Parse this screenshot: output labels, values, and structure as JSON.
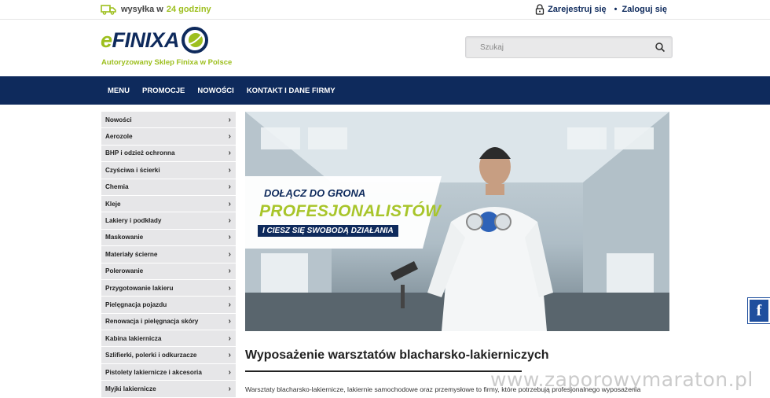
{
  "topbar": {
    "shipping_prefix": "wysyłka w",
    "shipping_highlight": "24 godziny",
    "register_label": "Zarejestruj się",
    "separator": "•",
    "login_label": "Zaloguj się"
  },
  "logo": {
    "word_e": "e",
    "word_rest": "FINIXA",
    "subtitle": "Autoryzowany Sklep Finixa w Polsce"
  },
  "search": {
    "placeholder": "Szukaj"
  },
  "nav": {
    "items": [
      "MENU",
      "PROMOCJE",
      "NOWOŚCI",
      "KONTAKT I DANE FIRMY"
    ]
  },
  "sidebar": {
    "categories": [
      "Nowości",
      "Aerozole",
      "BHP i odzież ochronna",
      "Czyściwa i ścierki",
      "Chemia",
      "Kleje",
      "Lakiery i podkłady",
      "Maskowanie",
      "Materiały ścierne",
      "Polerowanie",
      "Przygotowanie lakieru",
      "Pielęgnacja pojazdu",
      "Renowacja i pielęgnacja skóry",
      "Kabina lakiernicza",
      "Szlifierki, polerki i odkurzacze",
      "Pistolety lakiernicze i akcesoria",
      "Myjki lakiernicze"
    ],
    "chevron": "›"
  },
  "banner": {
    "line1": "DOŁĄCZ DO GRONA",
    "line2": "PROFESJONALISTÓW",
    "line3": "I CIESZ SIĘ SWOBODĄ DZIAŁANIA"
  },
  "content": {
    "heading": "Wyposażenie warsztatów blacharsko-lakierniczych",
    "paragraph": "Warsztaty blacharsko-lakiernicze, lakiernie samochodowe oraz przemysłowe to firmy, które potrzebują profesjonalnego wyposażenia"
  },
  "social": {
    "facebook_glyph": "f"
  },
  "watermark": "www.zaporowymaraton.pl",
  "colors": {
    "navy": "#0e2a5c",
    "green": "#9dbf1e"
  }
}
